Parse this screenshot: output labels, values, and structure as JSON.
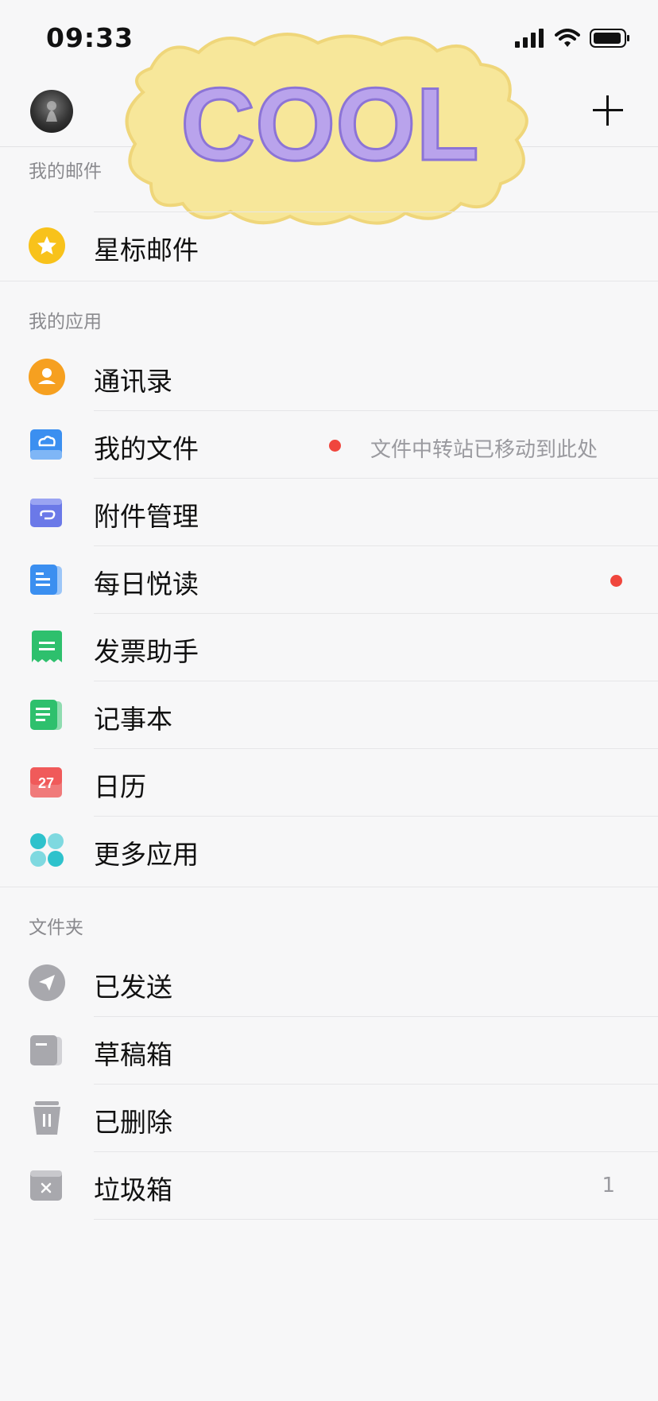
{
  "status_bar": {
    "time": "09:33"
  },
  "header": {
    "avatar": "avatar",
    "add_button": "+"
  },
  "sticker": {
    "text": "COOL"
  },
  "sections": {
    "my_mail": {
      "title": "我的邮件",
      "items": [
        {
          "label": "星标邮件",
          "icon": "star-icon"
        }
      ]
    },
    "my_apps": {
      "title": "我的应用",
      "items": [
        {
          "label": "通讯录",
          "icon": "contacts-icon"
        },
        {
          "label": "我的文件",
          "icon": "cloud-files-icon",
          "hint": "文件中转站已移动到此处",
          "badge_dot": true
        },
        {
          "label": "附件管理",
          "icon": "attachment-icon"
        },
        {
          "label": "每日悦读",
          "icon": "reading-icon",
          "badge_dot": true
        },
        {
          "label": "发票助手",
          "icon": "invoice-icon"
        },
        {
          "label": "记事本",
          "icon": "notepad-icon"
        },
        {
          "label": "日历",
          "icon": "calendar-icon",
          "calendar_day": "27"
        },
        {
          "label": "更多应用",
          "icon": "more-apps-icon"
        }
      ]
    },
    "folders": {
      "title": "文件夹",
      "items": [
        {
          "label": "已发送",
          "icon": "sent-icon"
        },
        {
          "label": "草稿箱",
          "icon": "drafts-icon"
        },
        {
          "label": "已删除",
          "icon": "trash-icon"
        },
        {
          "label": "垃圾箱",
          "icon": "spam-icon",
          "count": "1"
        }
      ]
    }
  },
  "colors": {
    "star": "#f8c21b",
    "contacts": "#f6a020",
    "files": "#3b8ff0",
    "attachment": "#6b79e8",
    "reading": "#3b8ff0",
    "invoice": "#2ec06d",
    "notepad": "#2ec06d",
    "calendar": "#f05a5a",
    "more_apps": "#2ec2cc",
    "folder_gray": "#a8a8ad",
    "red_dot": "#f0463d"
  }
}
